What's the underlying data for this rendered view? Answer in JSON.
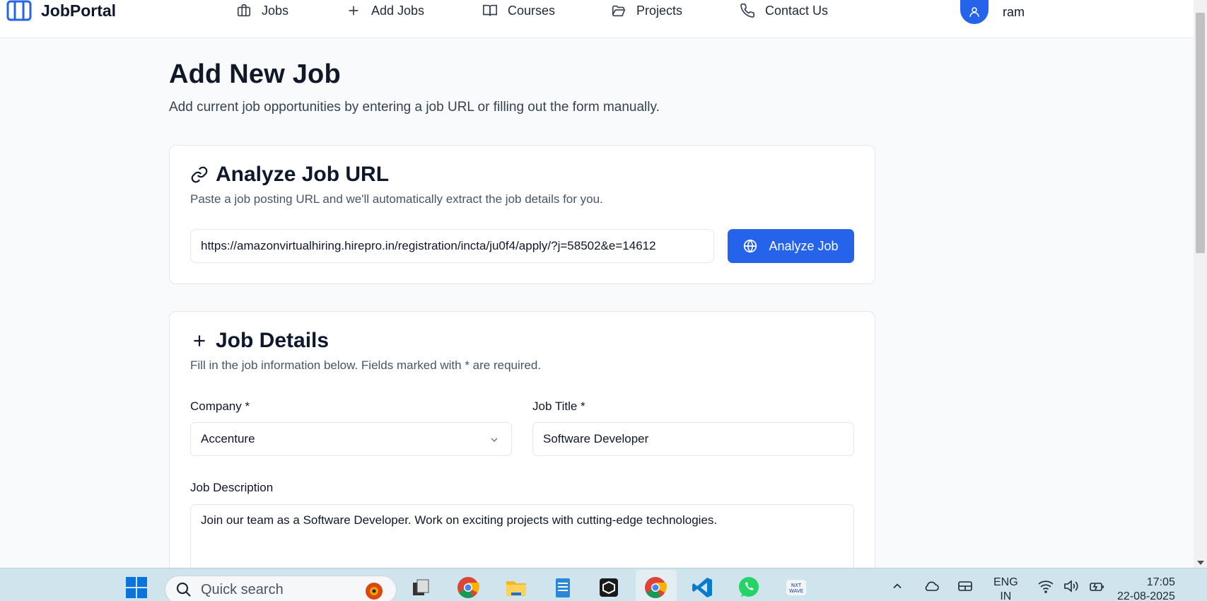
{
  "nav": {
    "brand": "JobPortal",
    "items": [
      {
        "label": "Jobs",
        "icon": "briefcase-icon"
      },
      {
        "label": "Add Jobs",
        "icon": "plus-icon"
      },
      {
        "label": "Courses",
        "icon": "book-open-icon"
      },
      {
        "label": "Projects",
        "icon": "folder-open-icon"
      },
      {
        "label": "Contact Us",
        "icon": "phone-icon"
      }
    ],
    "user_name": "ram"
  },
  "page": {
    "title": "Add New Job",
    "subtitle": "Add current job opportunities by entering a job URL or filling out the form manually."
  },
  "analyze": {
    "title": "Analyze Job URL",
    "description": "Paste a job posting URL and we'll automatically extract the job details for you.",
    "url_value": "https://amazonvirtualhiring.hirepro.in/registration/incta/ju0f4/apply/?j=58502&e=14612",
    "button_label": "Analyze Job"
  },
  "details": {
    "title": "Job Details",
    "description": "Fill in the job information below. Fields marked with * are required.",
    "company_label": "Company *",
    "company_value": "Accenture",
    "job_title_label": "Job Title *",
    "job_title_value": "Software Developer",
    "description_label": "Job Description",
    "description_value": "Join our team as a Software Developer. Work on exciting projects with cutting-edge technologies."
  },
  "taskbar": {
    "search_placeholder": "Quick search",
    "language": "ENG",
    "region": "IN",
    "time": "17:05",
    "date": "22-08-2025"
  },
  "colors": {
    "accent": "#2563eb",
    "page_bg": "#f8fafc",
    "taskbar_bg": "#cfe4ec"
  }
}
